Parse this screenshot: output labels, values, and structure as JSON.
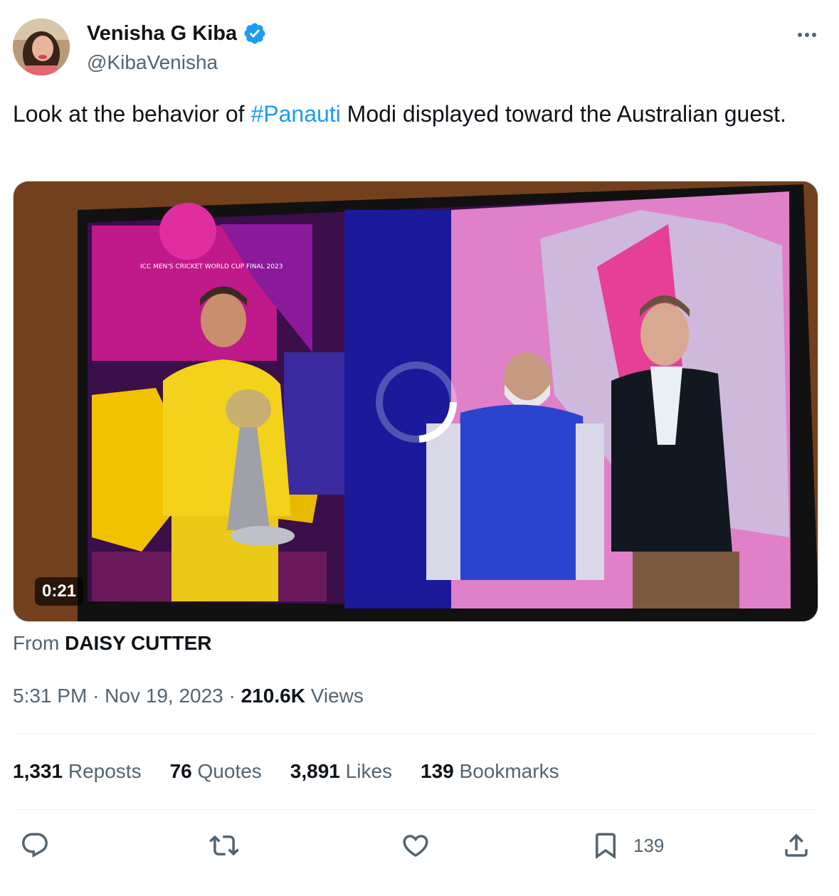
{
  "author": {
    "display_name": "Venisha G Kiba",
    "handle": "@KibaVenisha",
    "verified": true
  },
  "tweet": {
    "text_before": "Look at the behavior of ",
    "hashtag": "#Panauti",
    "text_after": " Modi displayed toward the Australian guest."
  },
  "media": {
    "duration": "0:21",
    "overlay_text": "ICC MEN'S CRICKET WORLD CUP FINAL 2023"
  },
  "attribution": {
    "prefix": "From",
    "source": "DAISY CUTTER"
  },
  "meta": {
    "time": "5:31 PM",
    "date": "Nov 19, 2023",
    "views_count": "210.6K",
    "views_label": "Views"
  },
  "stats": [
    {
      "count": "1,331",
      "label": "Reposts"
    },
    {
      "count": "76",
      "label": "Quotes"
    },
    {
      "count": "3,891",
      "label": "Likes"
    },
    {
      "count": "139",
      "label": "Bookmarks"
    }
  ],
  "actions": {
    "bookmark_count": "139"
  },
  "colors": {
    "accent": "#1d9bf0",
    "text_primary": "#0f1419",
    "text_secondary": "#536471"
  }
}
